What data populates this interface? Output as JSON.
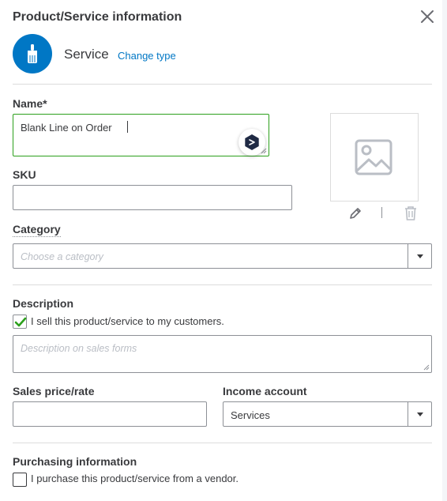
{
  "panel": {
    "title": "Product/Service information",
    "type_name": "Service",
    "change_type_label": "Change type"
  },
  "name": {
    "label": "Name*",
    "value": "Blank Line on Order"
  },
  "sku": {
    "label": "SKU",
    "value": ""
  },
  "category": {
    "label": "Category",
    "placeholder": "Choose a category"
  },
  "description": {
    "label": "Description",
    "sell_checkbox_label": "I sell this product/service to my customers.",
    "sell_checked": true,
    "placeholder": "Description on sales forms"
  },
  "sales_price": {
    "label": "Sales price/rate",
    "value": ""
  },
  "income_account": {
    "label": "Income account",
    "value": "Services"
  },
  "purchasing": {
    "label": "Purchasing information",
    "purchase_checkbox_label": "I purchase this product/service from a vendor.",
    "purchase_checked": false
  },
  "icons": {
    "close": "close-icon",
    "type": "paintbrush-icon",
    "assistant": "assistant-icon",
    "image_placeholder": "image-placeholder-icon",
    "edit": "pencil-icon",
    "delete": "trash-icon"
  },
  "colors": {
    "brand_blue": "#0077c5",
    "active_border": "#2ca01c",
    "check_green": "#2ca01c",
    "text": "#393a3d"
  }
}
